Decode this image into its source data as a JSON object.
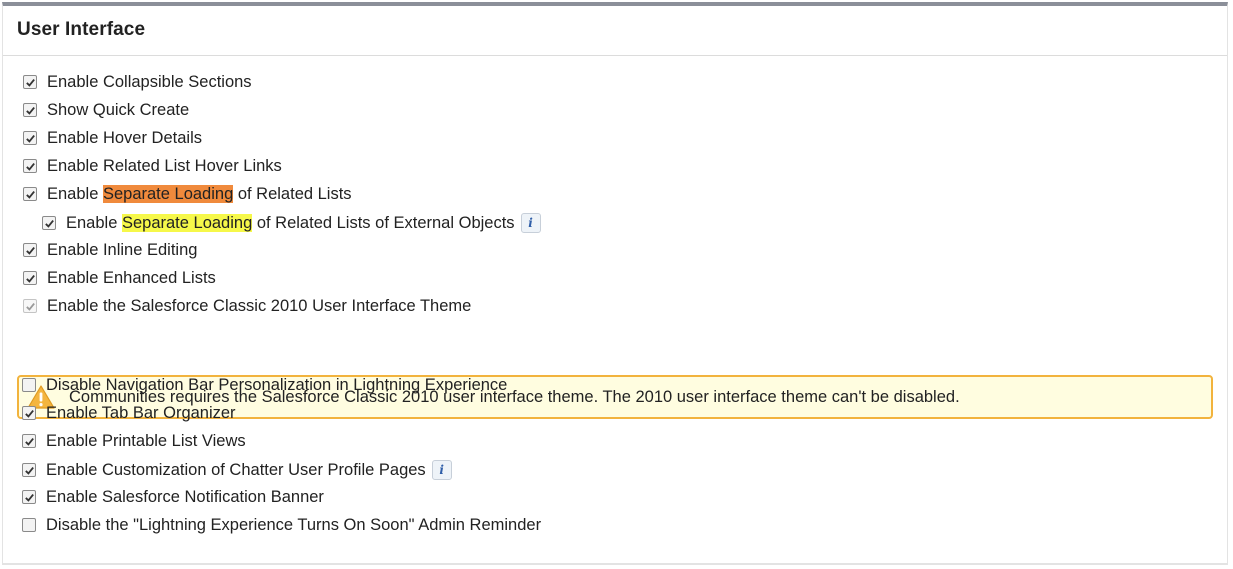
{
  "section": {
    "title": "User Interface"
  },
  "rows": [
    {
      "text": "Enable Collapsible Sections",
      "checked": true
    },
    {
      "text": "Show Quick Create",
      "checked": true
    },
    {
      "text": "Enable Hover Details",
      "checked": true
    },
    {
      "text": "Enable Related List Hover Links",
      "checked": true
    },
    {
      "prefix": "Enable ",
      "highlight": "Separate Loading",
      "suffix": " of Related Lists",
      "checked": true,
      "highlight_color": "#f08a3c"
    },
    {
      "prefix": "Enable ",
      "highlight": "Separate Loading",
      "suffix": " of Related Lists of External Objects",
      "checked": true,
      "highlight_color": "#f6f84a",
      "info_icon": "info-icon"
    },
    {
      "text": "Enable Inline Editing",
      "checked": true
    },
    {
      "text": "Enable Enhanced Lists",
      "checked": true
    },
    {
      "text": "Enable the Salesforce Classic 2010 User Interface Theme",
      "checked": true,
      "disabled": true
    },
    {
      "text": "Disable Navigation Bar Personalization in Lightning Experience",
      "checked": false
    },
    {
      "text": "Enable Tab Bar Organizer",
      "checked": true
    },
    {
      "text": "Enable Printable List Views",
      "checked": true
    },
    {
      "text": "Enable Customization of Chatter User Profile Pages",
      "checked": true,
      "info_icon": "info-icon"
    },
    {
      "text": "Enable Salesforce Notification Banner",
      "checked": true
    },
    {
      "text": "Disable the \"Lightning Experience Turns On Soon\" Admin Reminder",
      "checked": false
    }
  ],
  "warning": {
    "icon": "warning-icon",
    "message": "Communities requires the Salesforce Classic 2010 user interface theme. The 2010 user interface theme can't be disabled."
  },
  "colors": {
    "header_bar": "#8b8f99",
    "warning_border": "#f2b33d",
    "warning_bg": "#fffde0"
  }
}
